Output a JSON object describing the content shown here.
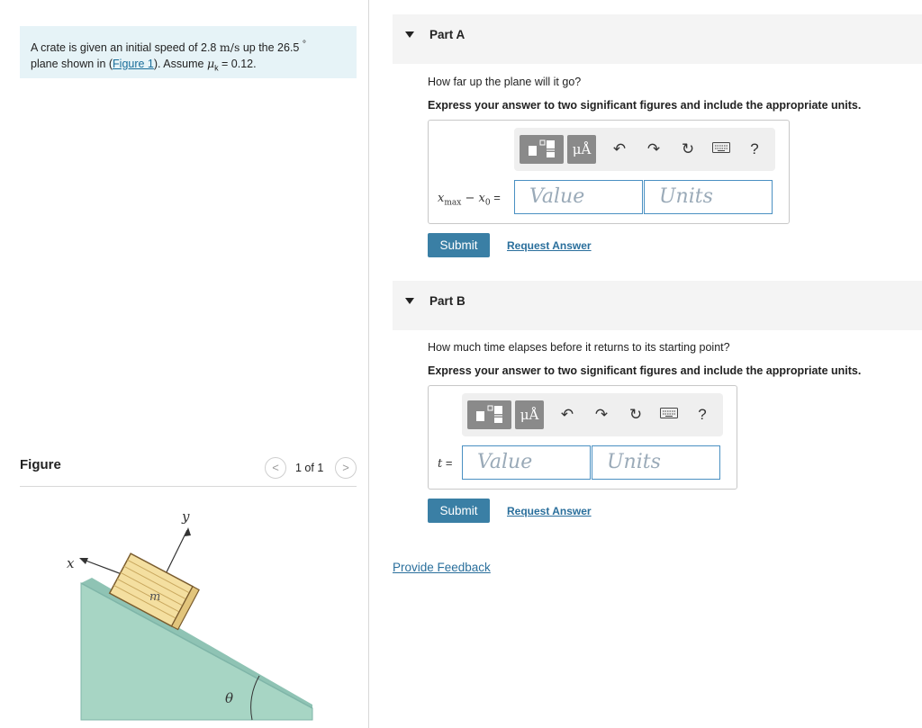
{
  "problem": {
    "text_before_speed": "A crate is given an initial speed of 2.8",
    "speed_unit": "m/s",
    "text_after_speed": " up the 26.5",
    "degree": "°",
    "text_line2_before_link": "plane shown in (",
    "figure_link": "Figure 1",
    "text_after_link": "). Assume ",
    "mu_symbol": "μ",
    "mu_sub": "k",
    "mu_value": " = 0.12."
  },
  "figure": {
    "title": "Figure",
    "prev_label": "<",
    "counter": "1 of 1",
    "next_label": ">",
    "labels": {
      "x": "x",
      "y": "y",
      "m": "m",
      "theta": "θ"
    },
    "colors": {
      "incline": "#a7d5c4",
      "incline_edge": "#7fb5a8",
      "crate": "#f4dfa0",
      "crate_edge": "#7a5c2e"
    }
  },
  "parts": [
    {
      "title": "Part A",
      "question": "How far up the plane will it go?",
      "instruction": "Express your answer to two significant figures and include the appropriate units.",
      "equation_label": {
        "var": "x",
        "sub": "max",
        "minus": " − ",
        "var2": "x",
        "sub2": "0",
        "equals": " ="
      },
      "value_placeholder": "Value",
      "units_placeholder": "Units",
      "submit": "Submit",
      "request": "Request Answer"
    },
    {
      "title": "Part B",
      "question": "How much time elapses before it returns to its starting point?",
      "instruction": "Express your answer to two significant figures and include the appropriate units.",
      "equation_label": {
        "var": "t",
        "equals": " ="
      },
      "value_placeholder": "Value",
      "units_placeholder": "Units",
      "submit": "Submit",
      "request": "Request Answer"
    }
  ],
  "toolbar": {
    "units_symbol": "μÅ",
    "help": "?"
  },
  "feedback": "Provide Feedback",
  "colors": {
    "accent": "#3a7fa5",
    "link": "#2a6f9c",
    "problem_bg": "#e6f3f7",
    "input_border": "#4a90c2"
  }
}
